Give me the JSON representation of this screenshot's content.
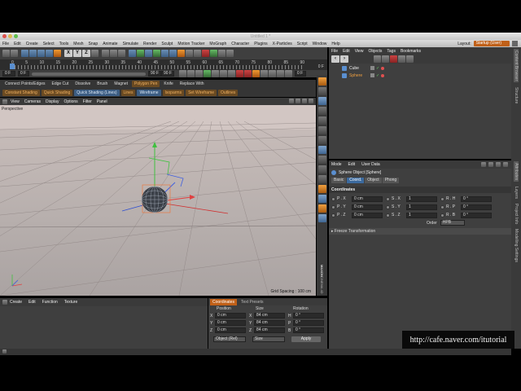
{
  "window": {
    "title": "Untitled 1 *"
  },
  "menubar": [
    "File",
    "Edit",
    "Create",
    "Select",
    "Tools",
    "Mesh",
    "Snap",
    "Animate",
    "Simulate",
    "Render",
    "Sculpt",
    "Motion Tracker",
    "MoGraph",
    "Character",
    "Plugins",
    "X-Particles",
    "Script",
    "Window",
    "Help"
  ],
  "layout": {
    "label": "Layout:",
    "value": "Startup (User)"
  },
  "timeline": {
    "ticks": [
      "0",
      "5",
      "10",
      "15",
      "20",
      "25",
      "30",
      "35",
      "40",
      "45",
      "50",
      "55",
      "60",
      "65",
      "70",
      "75",
      "80",
      "85",
      "90"
    ],
    "start_field": "0 F",
    "min_field": "0 F",
    "max_field": "90 F",
    "end_field": "90 F",
    "current": "0 F",
    "right_field": "0 F"
  },
  "mode_bar_1": [
    "Connect Points/Edges",
    "Edge Cut",
    "Dissolve",
    "Brush",
    "Magnet",
    "Polygon Pen",
    "Knife",
    "Replace With"
  ],
  "mode_bar_2": [
    "Constant Shading",
    "Quick Shading",
    "Quick Shading (Lines)",
    "Lines",
    "Wireframe",
    "Isoparms",
    "Set Wireframe",
    "Outlines"
  ],
  "viewport": {
    "menu": [
      "View",
      "Cameras",
      "Display",
      "Options",
      "Filter",
      "Panel"
    ],
    "label": "Perspective",
    "grid_spacing": "Grid Spacing : 100 cm"
  },
  "objects_panel": {
    "menu": [
      "File",
      "Edit",
      "View",
      "Objects",
      "Tags",
      "Bookmarks"
    ],
    "items": [
      {
        "name": "Cube"
      },
      {
        "name": "Sphere"
      }
    ]
  },
  "attributes": {
    "menu": [
      "Mode",
      "Edit",
      "User Data"
    ],
    "title": "Sphere Object [Sphere]",
    "tabs": [
      "Basic",
      "Coord.",
      "Object",
      "Phong"
    ],
    "active_tab": "Coord.",
    "section": "Coordinates",
    "rows": [
      {
        "p_label": "P . X",
        "p_val": "0 cm",
        "s_label": "S . X",
        "s_val": "1",
        "r_label": "R . H",
        "r_val": "0 °"
      },
      {
        "p_label": "P . Y",
        "p_val": "0 cm",
        "s_label": "S . Y",
        "s_val": "1",
        "r_label": "R . P",
        "r_val": "0 °"
      },
      {
        "p_label": "P . Z",
        "p_val": "0 cm",
        "s_label": "S . Z",
        "s_val": "1",
        "r_label": "R . B",
        "r_val": "0 °"
      }
    ],
    "order_label": "Order",
    "order_value": "HPB",
    "freeze": "▸ Freeze Transformation"
  },
  "material_bar": [
    "Create",
    "Edit",
    "Function",
    "Texture"
  ],
  "coordinates_panel": {
    "tabs": [
      "Coordinates",
      "Text Presets"
    ],
    "headers": [
      "Position",
      "Size",
      "Rotation"
    ],
    "rows": [
      {
        "axis": "X",
        "pos": "0 cm",
        "size_axis": "X",
        "size": "84 cm",
        "rot_axis": "H",
        "rot": "0 °"
      },
      {
        "axis": "Y",
        "pos": "0 cm",
        "size_axis": "Y",
        "size": "84 cm",
        "rot_axis": "P",
        "rot": "0 °"
      },
      {
        "axis": "Z",
        "pos": "0 cm",
        "size_axis": "Z",
        "size": "84 cm",
        "rot_axis": "B",
        "rot": "0 °"
      }
    ],
    "mode_select": "Object (Rel)",
    "size_select": "Size",
    "apply": "Apply"
  },
  "right_tabs": [
    "Content Browser",
    "Structure",
    "Attributes",
    "Layers",
    "Project Info",
    "Modelling Settings"
  ],
  "vertical_brand": [
    "MAXON",
    "CINEMA 4D"
  ],
  "watermark": "http://cafe.naver.com/itutorial",
  "colors": {
    "bg": "#3f3f3f",
    "accent": "#3c6a9e",
    "orange": "#e08a2a"
  }
}
